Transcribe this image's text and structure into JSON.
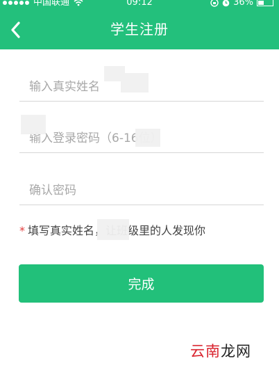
{
  "status_bar": {
    "carrier": "中国联通",
    "time": "09:12",
    "battery": "36%",
    "signal_icon": "signal-dots-icon",
    "wifi_icon": "wifi-icon",
    "lock_icon": "rotation-lock-icon",
    "alarm_icon": "alarm-icon"
  },
  "header": {
    "title": "学生注册",
    "back_icon": "chevron-left-icon"
  },
  "form": {
    "name_placeholder": "输入真实姓名",
    "password_placeholder": "输入登录密码（6-16位）",
    "confirm_placeholder": "确认密码",
    "hint_marker": "*",
    "hint_text": "填写真实姓名，让班级里的人发现你"
  },
  "actions": {
    "done_label": "完成"
  },
  "watermark": {
    "text_a": "云南",
    "text_b": "龙网"
  },
  "colors": {
    "brand_green": "#23c07c",
    "hint_star": "#e23b3b",
    "divider": "#d6d6d6"
  }
}
